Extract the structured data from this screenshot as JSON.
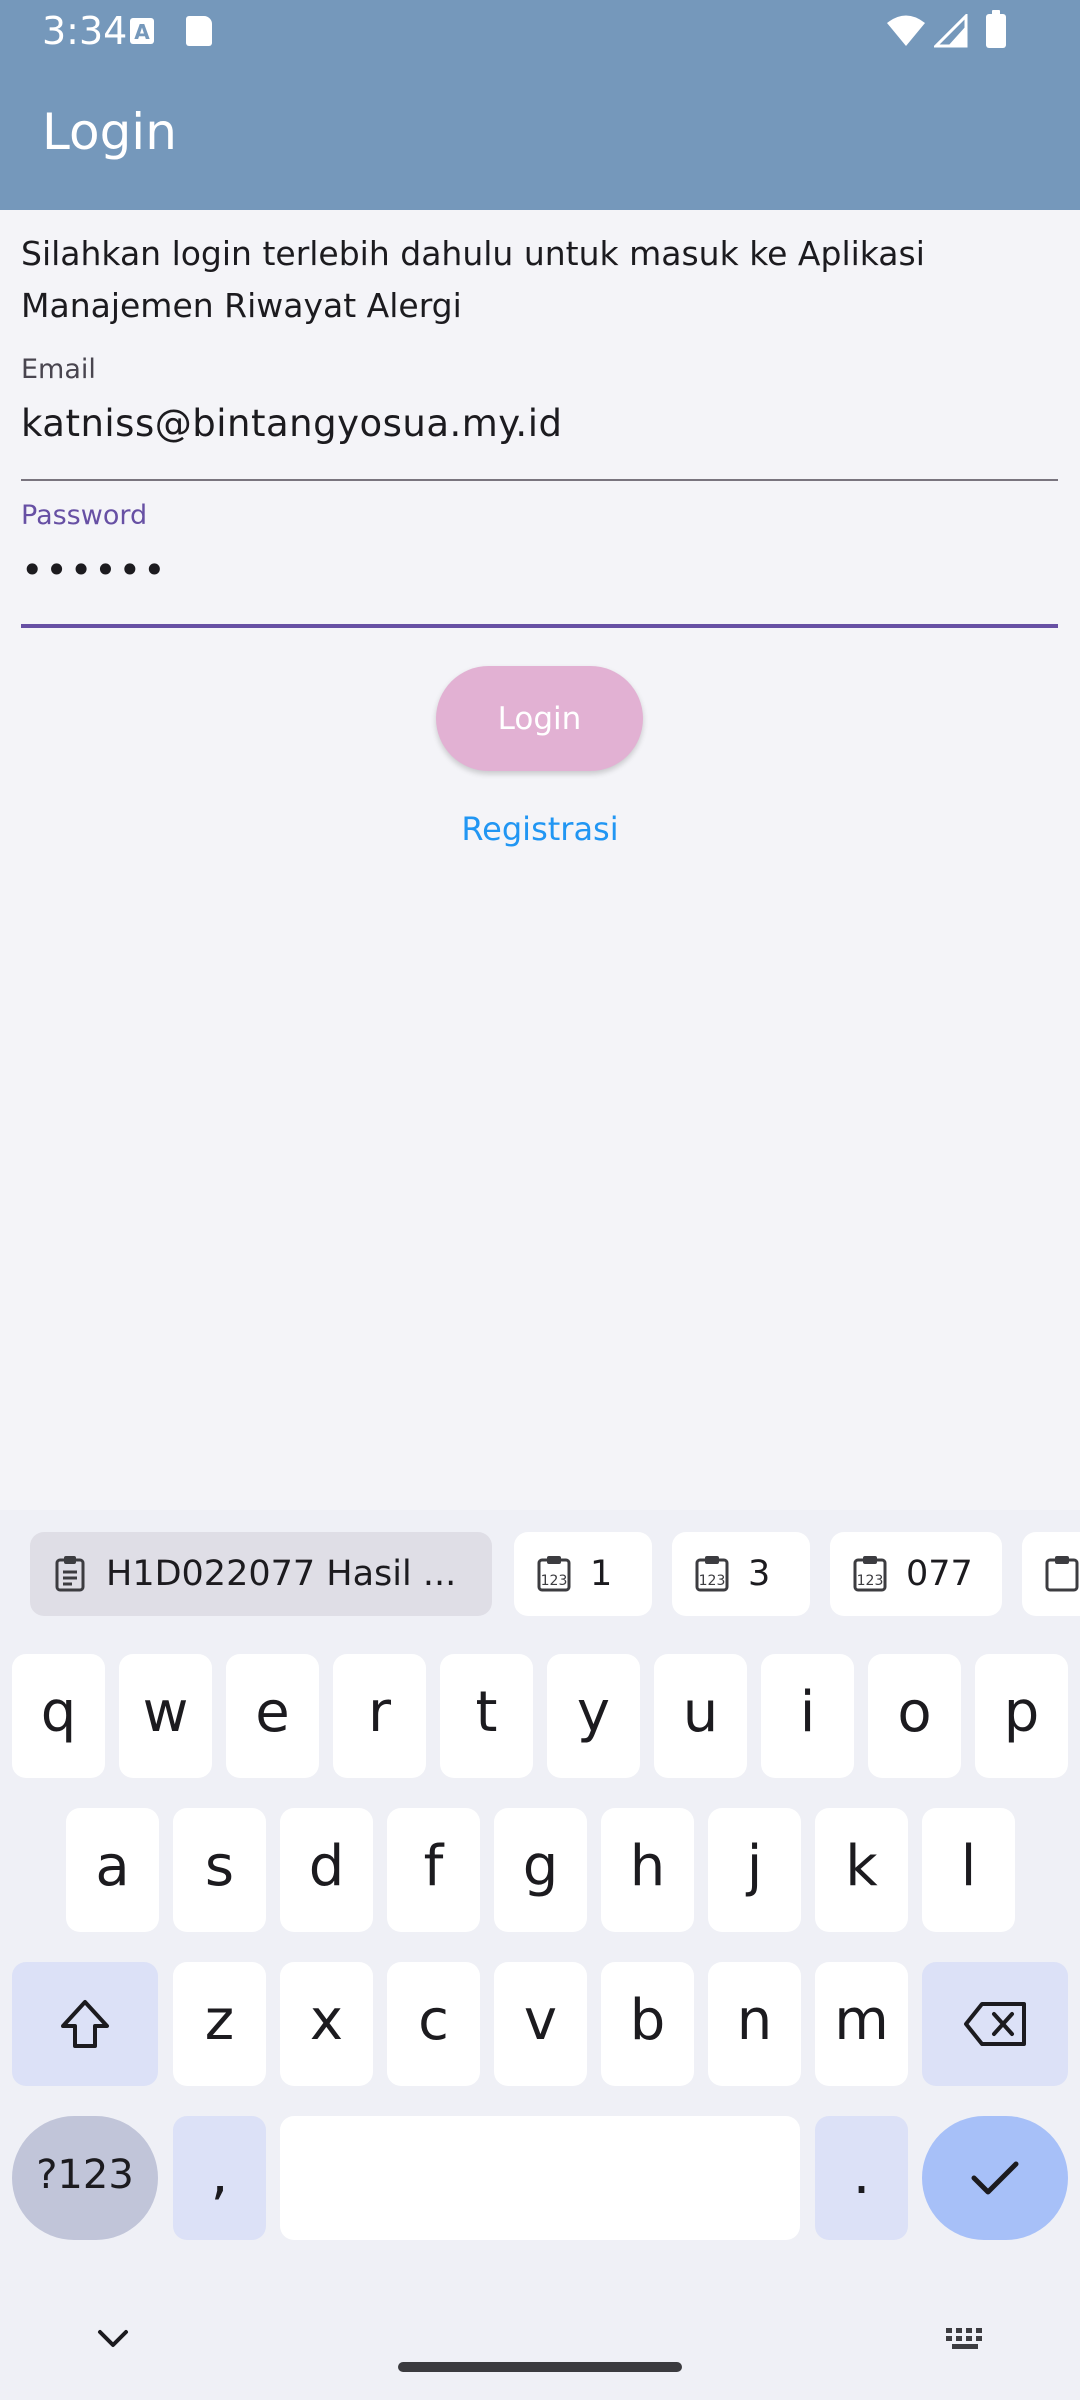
{
  "status_bar": {
    "time": "3:34",
    "notification_icons": [
      "text-a-icon",
      "sd-card-icon"
    ],
    "system_icons": [
      "wifi-icon",
      "signal-icon",
      "battery-icon"
    ]
  },
  "app_bar": {
    "title": "Login",
    "color": "#7598bb"
  },
  "content": {
    "intro_text": "Silahkan login terlebih dahulu untuk masuk ke Aplikasi Manajemen Riwayat Alergi",
    "email": {
      "label": "Email",
      "value": "katniss@bintangyosua.my.id"
    },
    "password": {
      "label": "Password",
      "value": "••••••",
      "focused": true
    },
    "login_button": "Login",
    "register_link": "Registrasi",
    "colors": {
      "login_button": "#e2b1d3",
      "focus": "#6750a4",
      "link": "#2196f3"
    }
  },
  "keyboard": {
    "clipboard": [
      "H1D022077 Hasil ...",
      "1",
      "3",
      "077"
    ],
    "row1": [
      "q",
      "w",
      "e",
      "r",
      "t",
      "y",
      "u",
      "i",
      "o",
      "p"
    ],
    "row2": [
      "a",
      "s",
      "d",
      "f",
      "g",
      "h",
      "j",
      "k",
      "l"
    ],
    "row3": [
      "z",
      "x",
      "c",
      "v",
      "b",
      "n",
      "m"
    ],
    "symbols_key": "?123",
    "comma_key": ",",
    "period_key": ".",
    "icons": [
      "shift-icon",
      "backspace-icon",
      "checkmark-icon",
      "collapse-keyboard-icon",
      "keyboard-switch-icon",
      "clipboard-icon",
      "clipboard-numbers-icon"
    ]
  }
}
